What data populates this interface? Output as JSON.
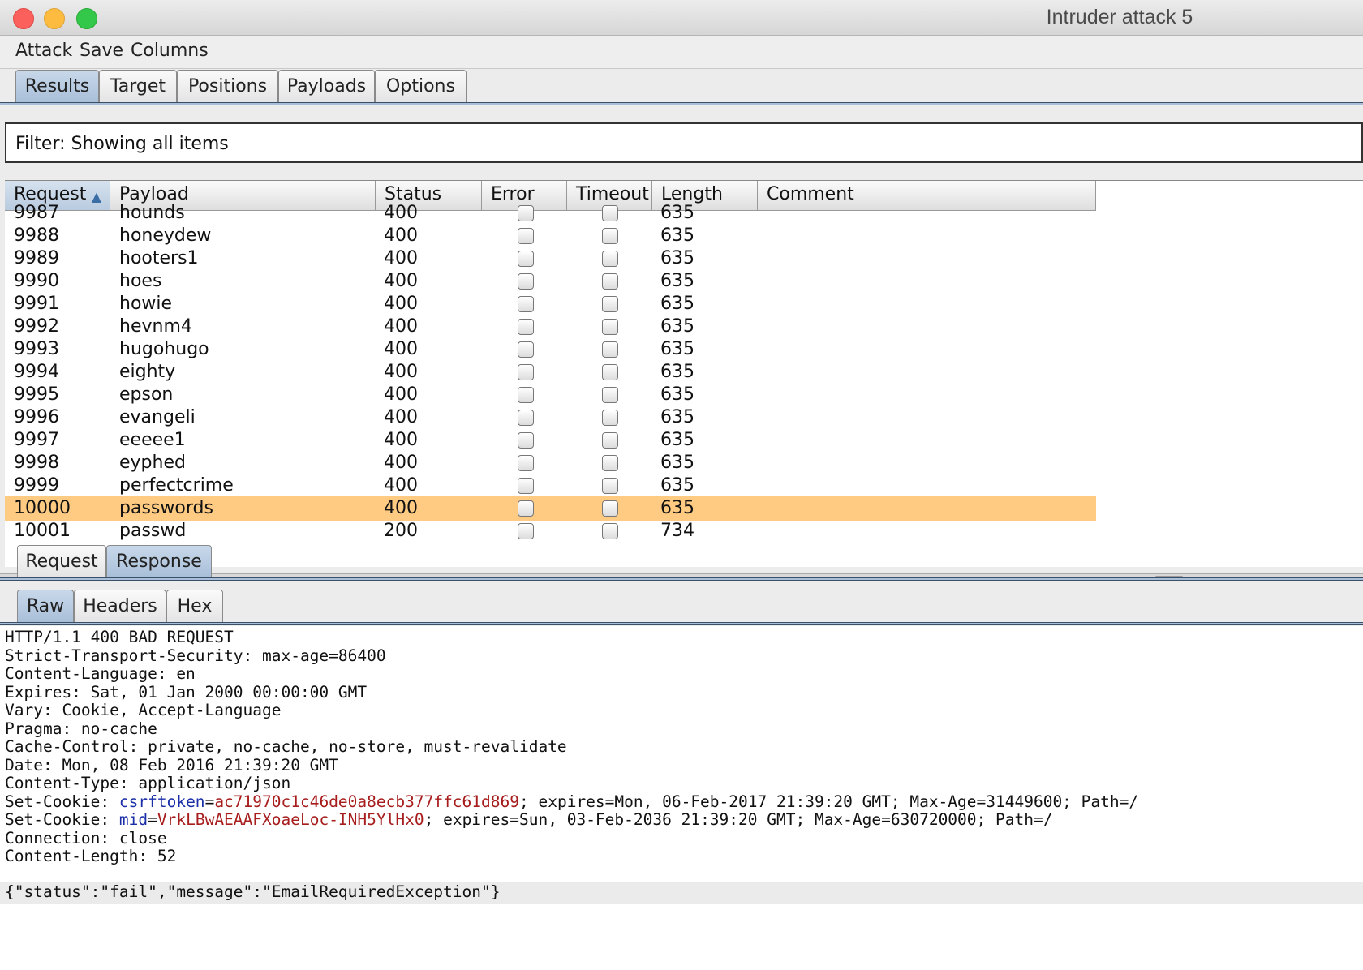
{
  "window": {
    "title": "Intruder attack 5"
  },
  "menu": [
    "Attack",
    "Save",
    "Columns"
  ],
  "main_tabs": [
    {
      "label": "Results",
      "active": true
    },
    {
      "label": "Target",
      "active": false
    },
    {
      "label": "Positions",
      "active": false
    },
    {
      "label": "Payloads",
      "active": false
    },
    {
      "label": "Options",
      "active": false
    }
  ],
  "filter": {
    "text": "Filter: Showing all items"
  },
  "table": {
    "columns": [
      "Request",
      "Payload",
      "Status",
      "Error",
      "Timeout",
      "Length",
      "Comment"
    ],
    "sorted_column": "Request",
    "sort_indicator": "▲",
    "rows": [
      {
        "request": "9987",
        "payload": "hounds",
        "status": "400",
        "length": "635"
      },
      {
        "request": "9988",
        "payload": "honeydew",
        "status": "400",
        "length": "635"
      },
      {
        "request": "9989",
        "payload": "hooters1",
        "status": "400",
        "length": "635"
      },
      {
        "request": "9990",
        "payload": "hoes",
        "status": "400",
        "length": "635"
      },
      {
        "request": "9991",
        "payload": "howie",
        "status": "400",
        "length": "635"
      },
      {
        "request": "9992",
        "payload": "hevnm4",
        "status": "400",
        "length": "635"
      },
      {
        "request": "9993",
        "payload": "hugohugo",
        "status": "400",
        "length": "635"
      },
      {
        "request": "9994",
        "payload": "eighty",
        "status": "400",
        "length": "635"
      },
      {
        "request": "9995",
        "payload": "epson",
        "status": "400",
        "length": "635"
      },
      {
        "request": "9996",
        "payload": "evangeli",
        "status": "400",
        "length": "635"
      },
      {
        "request": "9997",
        "payload": "eeeee1",
        "status": "400",
        "length": "635"
      },
      {
        "request": "9998",
        "payload": "eyphed",
        "status": "400",
        "length": "635"
      },
      {
        "request": "9999",
        "payload": "perfectcrime",
        "status": "400",
        "length": "635"
      },
      {
        "request": "10000",
        "payload": "passwords",
        "status": "400",
        "length": "635",
        "selected": true
      },
      {
        "request": "10001",
        "payload": "passwd",
        "status": "200",
        "length": "734"
      }
    ]
  },
  "message_tabs": [
    {
      "label": "Request",
      "active": false
    },
    {
      "label": "Response",
      "active": true
    }
  ],
  "view_tabs": [
    {
      "label": "Raw",
      "active": true
    },
    {
      "label": "Headers",
      "active": false
    },
    {
      "label": "Hex",
      "active": false
    }
  ],
  "response": {
    "lines": [
      "HTTP/1.1 400 BAD REQUEST",
      "Strict-Transport-Security: max-age=86400",
      "Content-Language: en",
      "Expires: Sat, 01 Jan 2000 00:00:00 GMT",
      "Vary: Cookie, Accept-Language",
      "Pragma: no-cache",
      "Cache-Control: private, no-cache, no-store, must-revalidate",
      "Date: Mon, 08 Feb 2016 21:39:20 GMT",
      "Content-Type: application/json"
    ],
    "cookie1": {
      "prefix": "Set-Cookie: ",
      "name": "csrftoken",
      "value": "ac71970c1c46de0a8ecb377ffc61d869",
      "rest": "; expires=Mon, 06-Feb-2017 21:39:20 GMT; Max-Age=31449600; Path=/"
    },
    "cookie2": {
      "prefix": "Set-Cookie: ",
      "name": "mid",
      "value": "VrkLBwAEAAFXoaeLoc-INH5YlHx0",
      "rest": "; expires=Sun, 03-Feb-2036 21:39:20 GMT; Max-Age=630720000; Path=/"
    },
    "tail_lines": [
      "Connection: close",
      "Content-Length: 52"
    ],
    "body": "{\"status\":\"fail\",\"message\":\"EmailRequiredException\"}"
  },
  "colors": {
    "selected_row": "#ffcb83",
    "cookie_name": "#1b2fa8",
    "cookie_value": "#a71d1d"
  }
}
